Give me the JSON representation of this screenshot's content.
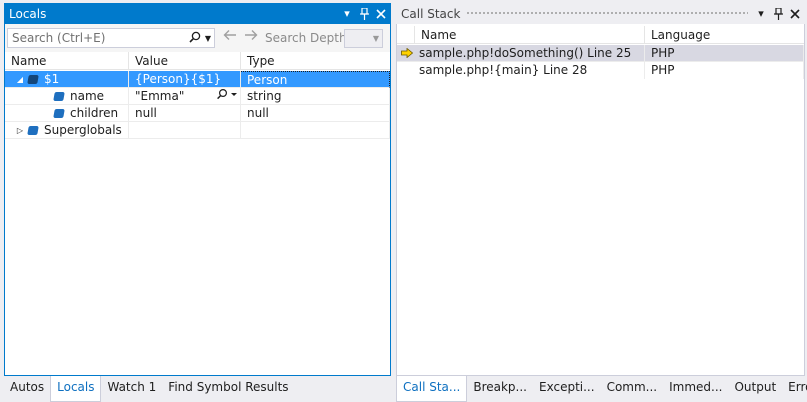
{
  "locals": {
    "title": "Locals",
    "search_placeholder": "Search (Ctrl+E)",
    "search_depth_label": "Search Depth:",
    "columns": {
      "name": "Name",
      "value": "Value",
      "type": "Type"
    },
    "rows": [
      {
        "name": "$1",
        "value": "{Person}{$1}",
        "type": "Person"
      },
      {
        "name": "name",
        "value": "\"Emma\"",
        "type": "string"
      },
      {
        "name": "children",
        "value": "null",
        "type": "null"
      },
      {
        "name": "Superglobals",
        "value": "",
        "type": ""
      }
    ],
    "tabs": [
      "Autos",
      "Locals",
      "Watch 1",
      "Find Symbol Results"
    ]
  },
  "callstack": {
    "title": "Call Stack",
    "columns": {
      "name": "Name",
      "language": "Language"
    },
    "rows": [
      {
        "name": "sample.php!doSomething() Line 25",
        "language": "PHP"
      },
      {
        "name": "sample.php!{main} Line 28",
        "language": "PHP"
      }
    ],
    "tabs": [
      "Call Sta...",
      "Breakp...",
      "Excepti...",
      "Comm...",
      "Immed...",
      "Output",
      "Error List"
    ]
  },
  "colors": {
    "accent": "#007acc",
    "selection": "#3399ff",
    "frame_highlight": "#d8d8e2",
    "current_frame_arrow": "#ffd200"
  },
  "icons": {
    "dropdown": "chevron-down-icon",
    "pin": "pin-icon",
    "close": "close-icon",
    "search": "search-icon",
    "back": "arrow-left-icon",
    "forward": "arrow-right-icon",
    "object": "object-icon",
    "current_frame": "current-frame-arrow-icon"
  }
}
